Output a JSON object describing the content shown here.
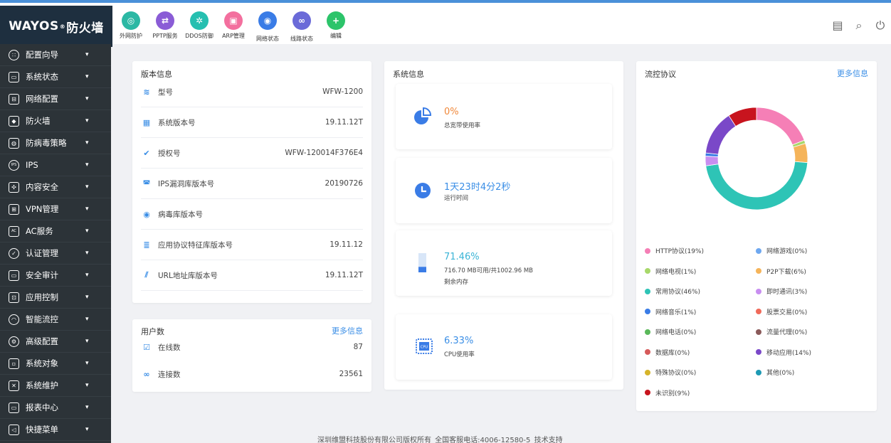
{
  "brand": {
    "logo_text": "WAYOS",
    "reg": "®",
    "logo_suffix": "防火墙"
  },
  "quick_access": [
    {
      "label": "外网防护",
      "icon": "globe-shield-icon",
      "color": "#2bb8a4",
      "glyph": "◎"
    },
    {
      "label": "PPTP服务",
      "icon": "swap-icon",
      "color": "#8a5cd6",
      "glyph": "⇄"
    },
    {
      "label": "DDOS防御",
      "icon": "gear-shield-icon",
      "color": "#26bfb0",
      "glyph": "✲"
    },
    {
      "label": "ARP管理",
      "icon": "arp-icon",
      "color": "#f36f9e",
      "glyph": "▣"
    },
    {
      "label": "网络状态",
      "icon": "network-status-icon",
      "color": "#3a7ce6",
      "glyph": "◉"
    },
    {
      "label": "线路状态",
      "icon": "line-status-icon",
      "color": "#6a6ad8",
      "glyph": "∞"
    },
    {
      "label": "编辑",
      "icon": "add-icon",
      "color": "#2cc46a",
      "glyph": "+"
    }
  ],
  "top_right": [
    {
      "icon": "panel-icon",
      "glyph": "▤"
    },
    {
      "icon": "search-icon",
      "glyph": "⌕"
    },
    {
      "icon": "power-icon",
      "glyph": "⏻"
    }
  ],
  "sidebar": [
    {
      "label": "配置向导",
      "icon": "wizard-icon",
      "glyph": "∷"
    },
    {
      "label": "系统状态",
      "icon": "monitor-icon",
      "glyph": "▭"
    },
    {
      "label": "网络配置",
      "icon": "network-config-icon",
      "glyph": "⊟"
    },
    {
      "label": "防火墙",
      "icon": "shield-icon",
      "glyph": "◆"
    },
    {
      "label": "防病毒策略",
      "icon": "antivirus-icon",
      "glyph": "◍"
    },
    {
      "label": "IPS",
      "icon": "ips-icon",
      "glyph": "IPS"
    },
    {
      "label": "内容安全",
      "icon": "content-security-icon",
      "glyph": "✣"
    },
    {
      "label": "VPN管理",
      "icon": "vpn-icon",
      "glyph": "⊞"
    },
    {
      "label": "AC服务",
      "icon": "ac-icon",
      "glyph": "AC"
    },
    {
      "label": "认证管理",
      "icon": "auth-icon",
      "glyph": "✓"
    },
    {
      "label": "安全审计",
      "icon": "audit-icon",
      "glyph": "▭"
    },
    {
      "label": "应用控制",
      "icon": "app-control-icon",
      "glyph": "⊡"
    },
    {
      "label": "智能流控",
      "icon": "flow-control-icon",
      "glyph": "◠"
    },
    {
      "label": "高级配置",
      "icon": "advanced-gear-icon",
      "glyph": "⚙"
    },
    {
      "label": "系统对象",
      "icon": "object-icon",
      "glyph": "▫"
    },
    {
      "label": "系统维护",
      "icon": "tools-icon",
      "glyph": "✕"
    },
    {
      "label": "报表中心",
      "icon": "report-icon",
      "glyph": "▭"
    },
    {
      "label": "快捷菜单",
      "icon": "shortcut-icon",
      "glyph": "◁"
    }
  ],
  "version": {
    "title": "版本信息",
    "rows": [
      {
        "label": "型号",
        "value": "WFW-1200",
        "icon": "layers-icon",
        "glyph": "≋"
      },
      {
        "label": "系统版本号",
        "value": "19.11.12T",
        "icon": "windows-icon",
        "glyph": "▦"
      },
      {
        "label": "授权号",
        "value": "WFW-120014F376E4",
        "icon": "badge-check-icon",
        "glyph": "✔"
      },
      {
        "label": "IPS漏洞库版本号",
        "value": "20190726",
        "icon": "ips-db-icon",
        "glyph": "◚"
      },
      {
        "label": "病毒库版本号",
        "value": "",
        "icon": "virus-db-icon",
        "glyph": "◉"
      },
      {
        "label": "应用协议特征库版本号",
        "value": "19.11.12",
        "icon": "protocol-db-icon",
        "glyph": "≣"
      },
      {
        "label": "URL地址库版本号",
        "value": "19.11.12T",
        "icon": "url-link-icon",
        "glyph": "⫽"
      }
    ]
  },
  "users": {
    "title": "用户数",
    "more": "更多信息",
    "rows": [
      {
        "label": "在线数",
        "value": "87",
        "icon": "online-user-icon",
        "glyph": "☑"
      },
      {
        "label": "连接数",
        "value": "23561",
        "icon": "link-icon",
        "glyph": "∞"
      }
    ]
  },
  "system": {
    "title": "系统信息",
    "bandwidth": {
      "value": "0%",
      "label": "总宽带使用率",
      "color": "#f0883a"
    },
    "uptime": {
      "value": "1天23时4分2秒",
      "label": "运行时间",
      "color": "#3a8ee6"
    },
    "memory": {
      "value": "71.46%",
      "detail": "716.70 MB可用/共1002.96 MB",
      "label": "剩余内存",
      "color": "#3ab4d6"
    },
    "cpu": {
      "value": "6.33%",
      "label": "CPU使用率",
      "color": "#3a8ee6"
    }
  },
  "protocol": {
    "title": "流控协议",
    "more": "更多信息",
    "legend": [
      {
        "label": "HTTP协议(19%)",
        "color": "#f57fb6",
        "value": 19
      },
      {
        "label": "网络游戏(0%)",
        "color": "#6ea8f0",
        "value": 0
      },
      {
        "label": "网络电视(1%)",
        "color": "#a8d86a",
        "value": 1
      },
      {
        "label": "P2P下载(6%)",
        "color": "#f5b45a",
        "value": 6
      },
      {
        "label": "常用协议(46%)",
        "color": "#2ec4b6",
        "value": 46
      },
      {
        "label": "即时通讯(3%)",
        "color": "#c88ef0",
        "value": 3
      },
      {
        "label": "网络音乐(1%)",
        "color": "#3a7ce6",
        "value": 1
      },
      {
        "label": "股票交易(0%)",
        "color": "#f06a5a",
        "value": 0
      },
      {
        "label": "网络电话(0%)",
        "color": "#5ab85a",
        "value": 0
      },
      {
        "label": "流量代理(0%)",
        "color": "#8a5a5a",
        "value": 0
      },
      {
        "label": "数据库(0%)",
        "color": "#d65a5a",
        "value": 0
      },
      {
        "label": "移动应用(14%)",
        "color": "#7a48c8",
        "value": 14
      },
      {
        "label": "特殊协议(0%)",
        "color": "#d6b42a",
        "value": 0
      },
      {
        "label": "其他(0%)",
        "color": "#1e9ab4",
        "value": 0
      },
      {
        "label": "未识别(9%)",
        "color": "#c8141e",
        "value": 9
      }
    ]
  },
  "footer": {
    "text": "深圳维盟科技股份有限公司版权所有    全国客服电话:4006-12580-5    技术支持"
  }
}
